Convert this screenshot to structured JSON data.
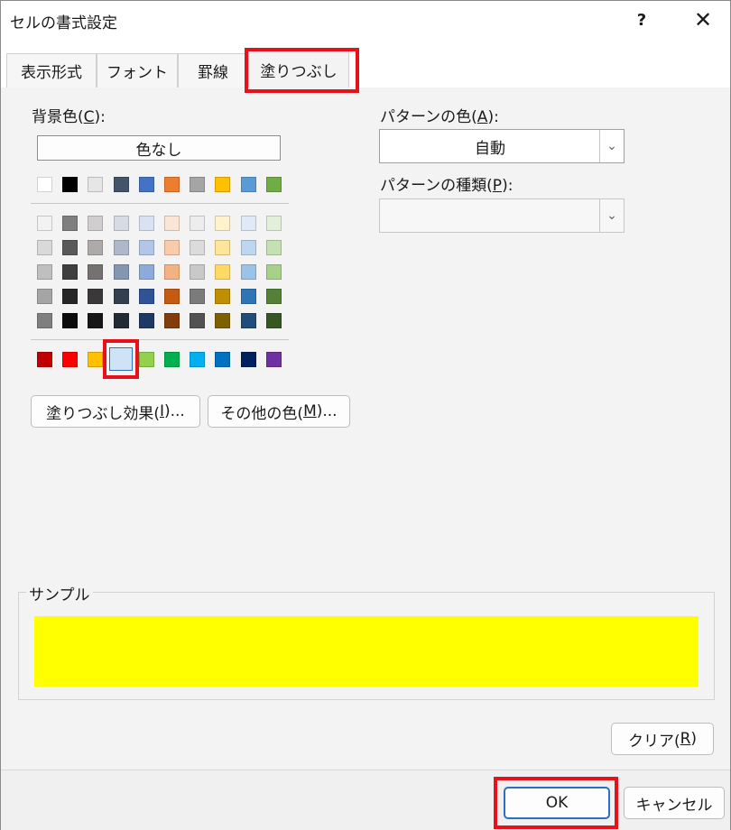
{
  "window": {
    "title": "セルの書式設定",
    "help": "?",
    "close": "✕"
  },
  "tabs": [
    {
      "label": "表示形式"
    },
    {
      "label": "フォント"
    },
    {
      "label": "罫線"
    },
    {
      "label": "塗りつぶし",
      "active": true
    }
  ],
  "fill": {
    "background_label_prefix": "背景色(",
    "background_label_key": "C",
    "background_label_suffix": "):",
    "no_color_label": "色なし",
    "theme_row": [
      "#ffffff",
      "#000000",
      "#e7e6e6",
      "#44546a",
      "#4472c4",
      "#ed7d31",
      "#a5a5a5",
      "#ffc000",
      "#5b9bd5",
      "#70ad47"
    ],
    "tint_rows": [
      [
        "#f2f2f2",
        "#7f7f7f",
        "#d0cece",
        "#d6dce4",
        "#d9e2f3",
        "#fbe5d5",
        "#ededed",
        "#fff2cc",
        "#deebf6",
        "#e2efd9"
      ],
      [
        "#d9d9d9",
        "#595959",
        "#aeaaaa",
        "#adb9ca",
        "#b4c6e7",
        "#f7cbac",
        "#dbdbdb",
        "#fee599",
        "#bdd7ee",
        "#c5e0b3"
      ],
      [
        "#bfbfbf",
        "#3f3f3f",
        "#757171",
        "#8496b0",
        "#8eaadb",
        "#f4b183",
        "#c9c9c9",
        "#ffd965",
        "#9cc3e5",
        "#a8d08d"
      ],
      [
        "#a5a5a5",
        "#262626",
        "#3a3838",
        "#323f4f",
        "#2f5496",
        "#c55a11",
        "#7b7b7b",
        "#bf8f00",
        "#2e75b5",
        "#538135"
      ],
      [
        "#7f7f7f",
        "#0c0c0c",
        "#171616",
        "#222a35",
        "#1f3864",
        "#833c0b",
        "#525252",
        "#7f6000",
        "#1e4e79",
        "#375623"
      ]
    ],
    "standard_row": [
      "#c00000",
      "#ff0000",
      "#ffc000",
      "#ffff00",
      "#92d050",
      "#00b050",
      "#00b0f0",
      "#0070c0",
      "#002060",
      "#7030a0"
    ],
    "selected_color": "#ffff00",
    "fill_effects": {
      "prefix": "塗りつぶし効果(",
      "key": "I",
      "suffix": ")..."
    },
    "more_colors": {
      "prefix": "その他の色(",
      "key": "M",
      "suffix": ")..."
    }
  },
  "pattern": {
    "color_label": {
      "prefix": "パターンの色(",
      "key": "A",
      "suffix": "):"
    },
    "color_value": "自動",
    "style_label": {
      "prefix": "パターンの種類(",
      "key": "P",
      "suffix": "):"
    },
    "style_value": ""
  },
  "sample": {
    "label": "サンプル",
    "color": "#ffff00"
  },
  "clear": {
    "prefix": "クリア(",
    "key": "R",
    "suffix": ")"
  },
  "footer": {
    "ok_label": "OK",
    "cancel_label": "キャンセル"
  },
  "highlight_color": "#e8101a"
}
